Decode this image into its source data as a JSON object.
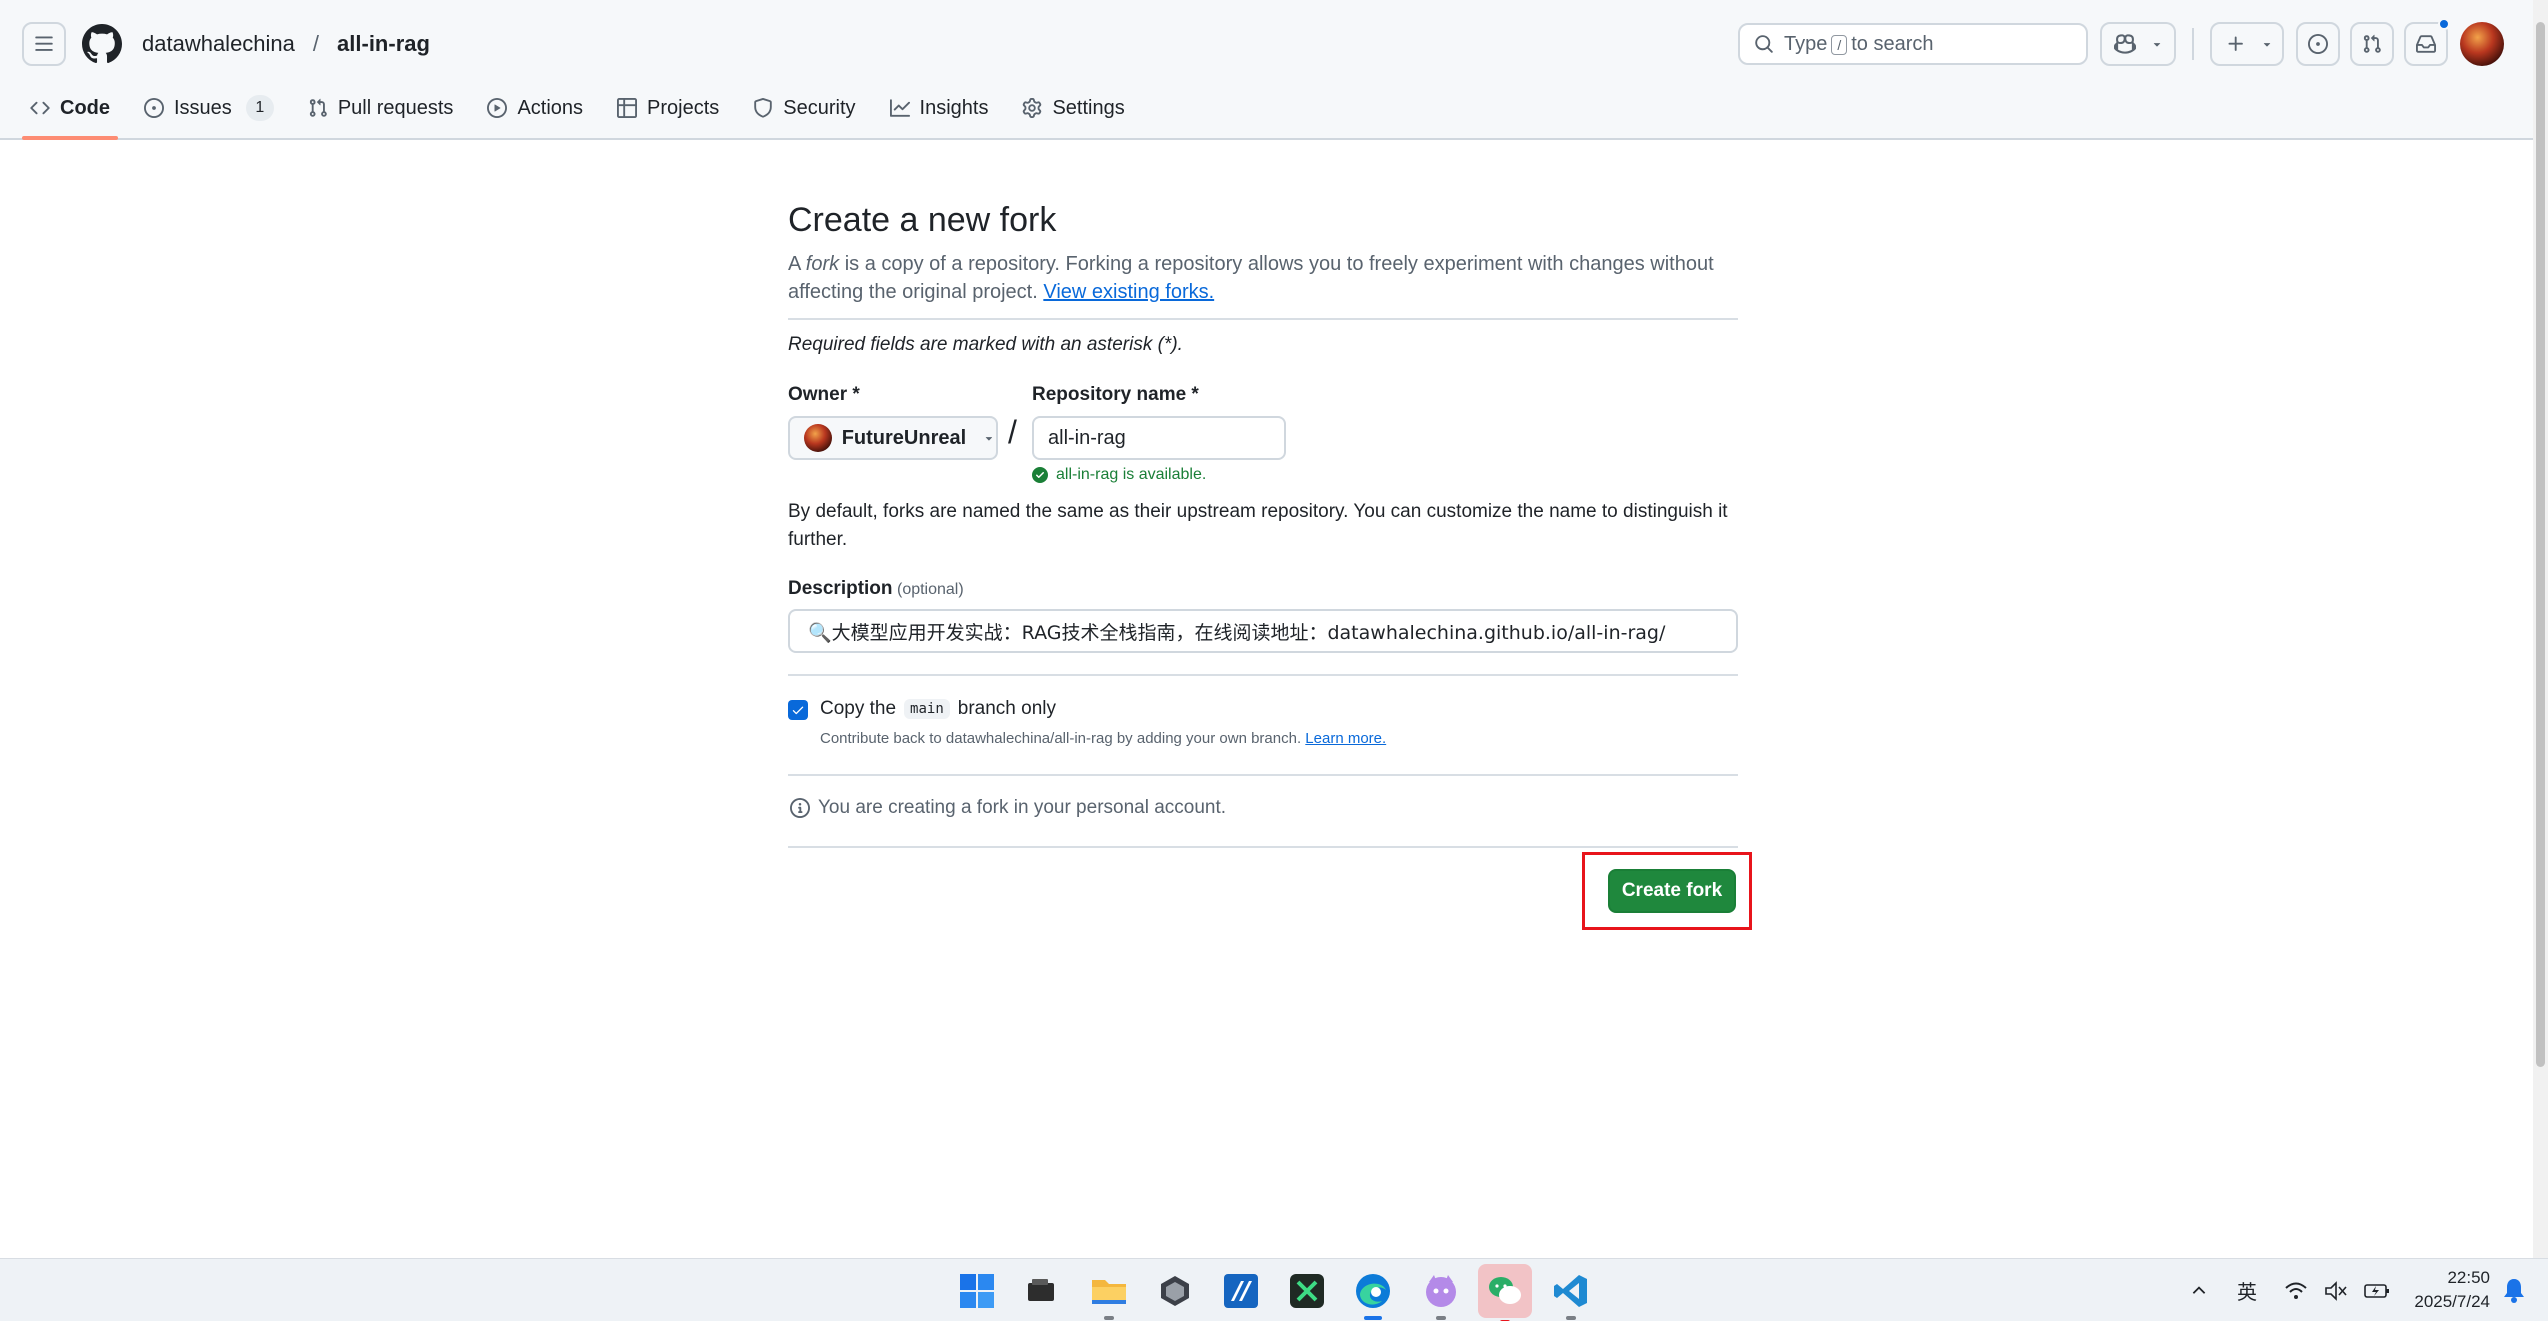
{
  "header": {
    "owner": "datawhalechina",
    "separator": "/",
    "repo": "all-in-rag",
    "search": {
      "prefix": "Type",
      "key": "/",
      "suffix": "to search"
    },
    "plus_label": "+"
  },
  "tabs": [
    {
      "label": "Code",
      "icon": "code-icon",
      "active": true
    },
    {
      "label": "Issues",
      "icon": "issue-opened-icon",
      "counter": "1"
    },
    {
      "label": "Pull requests",
      "icon": "git-pull-request-icon"
    },
    {
      "label": "Actions",
      "icon": "play-icon"
    },
    {
      "label": "Projects",
      "icon": "table-icon"
    },
    {
      "label": "Security",
      "icon": "shield-icon"
    },
    {
      "label": "Insights",
      "icon": "graph-icon"
    },
    {
      "label": "Settings",
      "icon": "gear-icon"
    }
  ],
  "form": {
    "title": "Create a new fork",
    "intro_a": "A ",
    "intro_fork": "fork",
    "intro_b": " is a copy of a repository. Forking a repository allows you to freely experiment with changes without affecting the original project. ",
    "view_forks_link": "View existing forks.",
    "required_note": "Required fields are marked with an asterisk (*).",
    "owner_label": "Owner *",
    "owner_value": "FutureUnreal",
    "slash": "/",
    "repo_label": "Repository name *",
    "repo_value": "all-in-rag",
    "availability": "all-in-rag is available.",
    "default_note": "By default, forks are named the same as their upstream repository. You can customize the name to distinguish it further.",
    "description_label": "Description",
    "description_optional": "(optional)",
    "description_value": "🔍大模型应用开发实战：RAG技术全栈指南，在线阅读地址：datawhalechina.github.io/all-in-rag/",
    "copy_checked": true,
    "copy_label_a": "Copy the",
    "copy_branch": "main",
    "copy_label_b": "branch only",
    "copy_help": "Contribute back to datawhalechina/all-in-rag by adding your own branch.",
    "learn_more": "Learn more.",
    "account_note": "You are creating a fork in your personal account.",
    "submit_label": "Create fork"
  },
  "colors": {
    "primary_button": "#1f883d",
    "link": "#0969da",
    "success": "#1a7f37",
    "active_tab_underline": "#fd8c73",
    "highlight_box": "#e8141b"
  },
  "taskbar": {
    "apps": [
      "windows-start-icon",
      "file-manager-icon",
      "folder-icon",
      "cube-app-icon",
      "text-editor-app-icon",
      "capcut-icon",
      "edge-browser-icon",
      "cat-app-icon",
      "wechat-icon",
      "vscode-icon"
    ],
    "ime": "英",
    "time": "22:50",
    "date": "2025/7/24"
  }
}
